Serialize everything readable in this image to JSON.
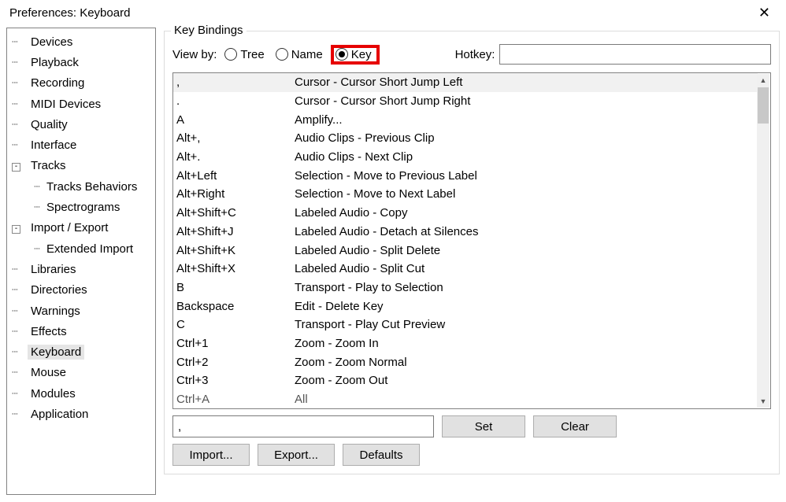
{
  "window": {
    "title": "Preferences: Keyboard",
    "close_glyph": "✕"
  },
  "sidebar": {
    "items": [
      {
        "label": "Devices",
        "depth": 0
      },
      {
        "label": "Playback",
        "depth": 0
      },
      {
        "label": "Recording",
        "depth": 0
      },
      {
        "label": "MIDI Devices",
        "depth": 0
      },
      {
        "label": "Quality",
        "depth": 0
      },
      {
        "label": "Interface",
        "depth": 0
      },
      {
        "label": "Tracks",
        "depth": 0,
        "expander": "-"
      },
      {
        "label": "Tracks Behaviors",
        "depth": 1
      },
      {
        "label": "Spectrograms",
        "depth": 1
      },
      {
        "label": "Import / Export",
        "depth": 0,
        "expander": "-"
      },
      {
        "label": "Extended Import",
        "depth": 1
      },
      {
        "label": "Libraries",
        "depth": 0
      },
      {
        "label": "Directories",
        "depth": 0
      },
      {
        "label": "Warnings",
        "depth": 0
      },
      {
        "label": "Effects",
        "depth": 0
      },
      {
        "label": "Keyboard",
        "depth": 0,
        "selected": true
      },
      {
        "label": "Mouse",
        "depth": 0
      },
      {
        "label": "Modules",
        "depth": 0
      },
      {
        "label": "Application",
        "depth": 0
      }
    ]
  },
  "panel": {
    "groupbox_title": "Key Bindings",
    "viewby_label": "View by:",
    "radios": {
      "tree": "Tree",
      "name": "Name",
      "key": "Key"
    },
    "selected_radio": "key",
    "hotkey_label": "Hotkey:",
    "hotkey_value": "",
    "bindings": [
      {
        "key": ",",
        "desc": "Cursor - Cursor Short Jump Left",
        "selected": true
      },
      {
        "key": ".",
        "desc": "Cursor - Cursor Short Jump Right"
      },
      {
        "key": "A",
        "desc": "Amplify..."
      },
      {
        "key": "Alt+,",
        "desc": "Audio Clips - Previous Clip"
      },
      {
        "key": "Alt+.",
        "desc": "Audio Clips - Next Clip"
      },
      {
        "key": "Alt+Left",
        "desc": "Selection - Move to Previous Label"
      },
      {
        "key": "Alt+Right",
        "desc": "Selection - Move to Next Label"
      },
      {
        "key": "Alt+Shift+C",
        "desc": "Labeled Audio - Copy"
      },
      {
        "key": "Alt+Shift+J",
        "desc": "Labeled Audio - Detach at Silences"
      },
      {
        "key": "Alt+Shift+K",
        "desc": "Labeled Audio - Split Delete"
      },
      {
        "key": "Alt+Shift+X",
        "desc": "Labeled Audio - Split Cut"
      },
      {
        "key": "B",
        "desc": "Transport - Play to Selection"
      },
      {
        "key": "Backspace",
        "desc": "Edit - Delete Key"
      },
      {
        "key": "C",
        "desc": "Transport - Play Cut Preview"
      },
      {
        "key": "Ctrl+1",
        "desc": "Zoom - Zoom In"
      },
      {
        "key": "Ctrl+2",
        "desc": "Zoom - Zoom Normal"
      },
      {
        "key": "Ctrl+3",
        "desc": "Zoom - Zoom Out"
      },
      {
        "key": "Ctrl+A",
        "desc": "All",
        "faded": true
      }
    ],
    "selected_key_input": ",",
    "buttons": {
      "set": "Set",
      "clear": "Clear",
      "import": "Import...",
      "export": "Export...",
      "defaults": "Defaults"
    }
  },
  "highlight": {
    "radio": "key"
  }
}
